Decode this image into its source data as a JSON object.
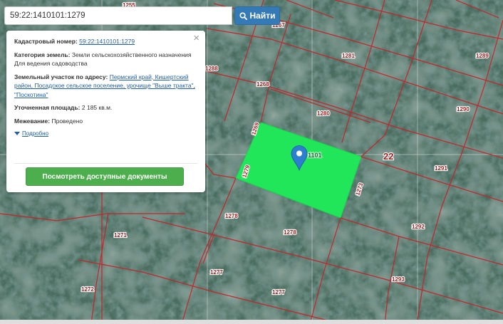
{
  "search": {
    "value": "59:22:1410101:1279",
    "button_label": "Найти"
  },
  "popup": {
    "cadastral_label": "Кадастровый номер:",
    "cadastral_value": "59:22:1410101:1279",
    "category_label": "Категория земель:",
    "category_value": "Земли сельскохозяйственного назначения",
    "use_value": "Для ведения садоводства",
    "address_label": "Земельный участок по адресу:",
    "address_value": "Пермский край, Кишертский район, Посадское сельское поселение, урочище \"Выше тракта\", \"Поскотина\"",
    "area_label": "Уточненная площадь:",
    "area_value": "2 185 кв.м.",
    "survey_label": "Межевание:",
    "survey_value": "Проведено",
    "more_link": "Подробно",
    "docs_button": "Посмотреть доступные документы",
    "close_symbol": "×"
  },
  "map": {
    "selected_parcel_color": "#22e65a",
    "boundary_color": "#c4262c",
    "marker_color": "#2c7fcf",
    "parcel_labels": [
      "1255",
      "1267",
      "1281",
      "1289",
      "1288",
      "1268",
      "1280",
      "1290",
      "1269",
      "1279",
      "1101",
      "22",
      "1291",
      "1273",
      "1278",
      "1292",
      "1271",
      "1278",
      "1277",
      "1293",
      "1272",
      "1277"
    ]
  }
}
